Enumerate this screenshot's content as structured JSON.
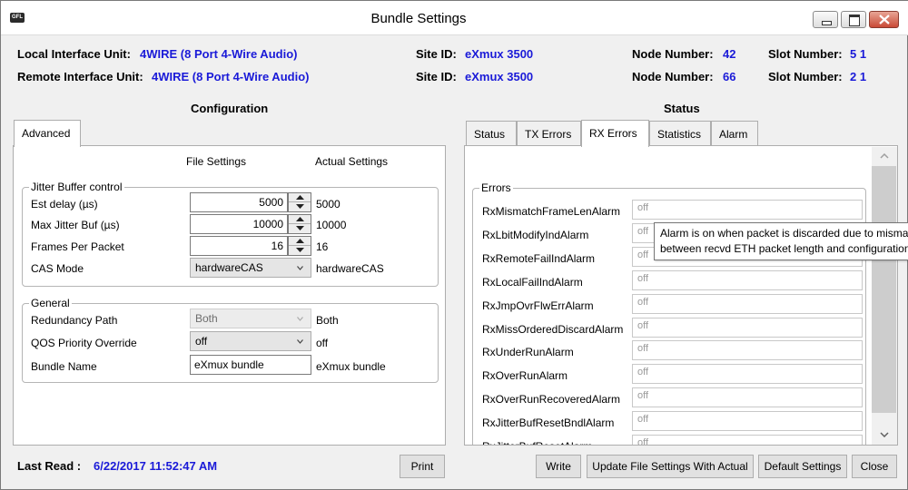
{
  "window": {
    "title": "Bundle Settings",
    "icon": "app-icon"
  },
  "header": {
    "local_label": "Local Interface Unit:",
    "local_value": "4WIRE (8 Port 4-Wire Audio)",
    "remote_label": "Remote Interface Unit:",
    "remote_value": "4WIRE (8 Port 4-Wire Audio)",
    "site_id_label": "Site ID:",
    "local_site_id": "eXmux 3500",
    "remote_site_id": "eXmux 3500",
    "node_label": "Node Number:",
    "local_node": "42",
    "remote_node": "66",
    "slot_label": "Slot Number:",
    "local_slot": "5 1",
    "remote_slot": "2 1"
  },
  "configuration": {
    "title": "Configuration",
    "tab": "Advanced",
    "file_settings_header": "File Settings",
    "actual_settings_header": "Actual Settings",
    "jitter": {
      "legend": "Jitter Buffer control",
      "est_delay_label": "Est delay (µs)",
      "est_delay_value": "5000",
      "est_delay_actual": "5000",
      "max_jitter_label": "Max Jitter Buf (µs)",
      "max_jitter_value": "10000",
      "max_jitter_actual": "10000",
      "frames_label": "Frames Per Packet",
      "frames_value": "16",
      "frames_actual": "16",
      "cas_label": "CAS Mode",
      "cas_value": "hardwareCAS",
      "cas_actual": "hardwareCAS"
    },
    "general": {
      "legend": "General",
      "redundancy_label": "Redundancy Path",
      "redundancy_value": "Both",
      "redundancy_actual": "Both",
      "qos_label": "QOS Priority Override",
      "qos_value": "off",
      "qos_actual": "off",
      "bundle_label": "Bundle Name",
      "bundle_value": "eXmux bundle",
      "bundle_actual": "eXmux bundle"
    }
  },
  "status": {
    "title": "Status",
    "tabs": [
      "Status",
      "TX Errors",
      "RX Errors",
      "Statistics",
      "Alarm"
    ],
    "active_tab": "RX Errors",
    "errors_legend": "Errors",
    "errors": [
      {
        "label": "RxMismatchFrameLenAlarm",
        "value": "off"
      },
      {
        "label": "RxLbitModifyIndAlarm",
        "value": "off"
      },
      {
        "label": "RxRemoteFailIndAlarm",
        "value": "off"
      },
      {
        "label": "RxLocalFailIndAlarm",
        "value": "off"
      },
      {
        "label": "RxJmpOvrFlwErrAlarm",
        "value": "off"
      },
      {
        "label": "RxMissOrderedDiscardAlarm",
        "value": "off"
      },
      {
        "label": "RxUnderRunAlarm",
        "value": "off"
      },
      {
        "label": "RxOverRunAlarm",
        "value": "off"
      },
      {
        "label": "RxOverRunRecoveredAlarm",
        "value": "off"
      },
      {
        "label": "RxJitterBufResetBndlAlarm",
        "value": "off"
      },
      {
        "label": "RxJitterBufResetAlarm",
        "value": "off"
      }
    ],
    "tooltip_line1": "Alarm is on when packet is discarded due to mismat",
    "tooltip_line2": "between recvd ETH packet length and configuration"
  },
  "footer": {
    "last_read_label": "Last Read :",
    "last_read_value": "6/22/2017 11:52:47 AM",
    "print": "Print",
    "write": "Write",
    "update": "Update File Settings With Actual",
    "default": "Default Settings",
    "close": "Close"
  },
  "colors": {
    "value_blue": "#1a1ad8",
    "close_red": "#c94a36"
  }
}
